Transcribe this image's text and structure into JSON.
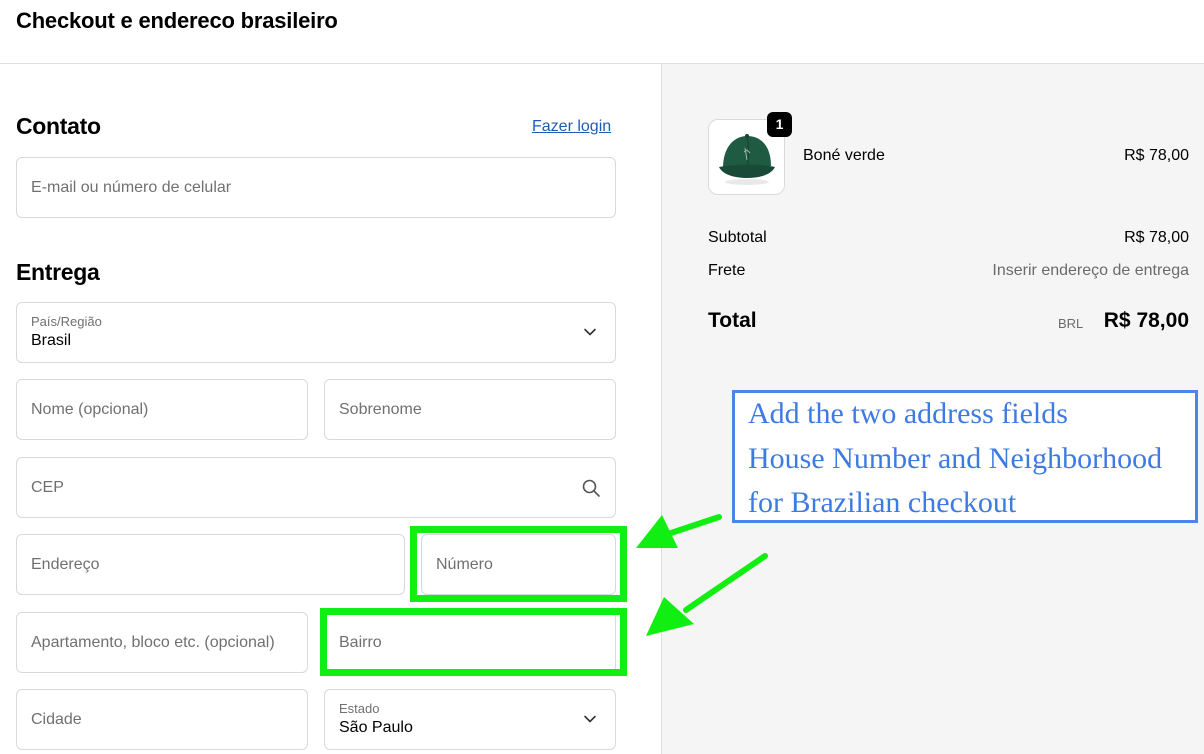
{
  "page_title": "Checkout e endereco brasileiro",
  "contact": {
    "heading": "Contato",
    "login_link": "Fazer login",
    "email_placeholder": "E-mail ou número de celular"
  },
  "delivery": {
    "heading": "Entrega",
    "country_label": "País/Região",
    "country_value": "Brasil",
    "first_name_placeholder": "Nome (opcional)",
    "last_name_placeholder": "Sobrenome",
    "cep_placeholder": "CEP",
    "address_placeholder": "Endereço",
    "number_placeholder": "Número",
    "apartment_placeholder": "Apartamento, bloco etc. (opcional)",
    "neighborhood_placeholder": "Bairro",
    "city_placeholder": "Cidade",
    "state_label": "Estado",
    "state_value": "São Paulo"
  },
  "order_summary": {
    "item": {
      "name": "Boné verde",
      "price": "R$ 78,00",
      "quantity": "1"
    },
    "subtotal_label": "Subtotal",
    "subtotal_value": "R$ 78,00",
    "shipping_label": "Frete",
    "shipping_value": "Inserir endereço de entrega",
    "total_label": "Total",
    "total_currency": "BRL",
    "total_value": "R$ 78,00"
  },
  "annotation": {
    "lines": [
      "Add the two address fields",
      "House Number and Neighborhood",
      "for Brazilian checkout"
    ]
  },
  "colors": {
    "highlight": "#11ee11",
    "note_border": "#4a86e8",
    "note_text": "#3d7be3",
    "link": "#1f5bb5",
    "summary_bg": "#f5f5f5",
    "cap_green": "#1f5a43"
  },
  "icons": [
    "chevron-down-icon",
    "search-icon",
    "cap-product-image",
    "arrow-icon"
  ]
}
